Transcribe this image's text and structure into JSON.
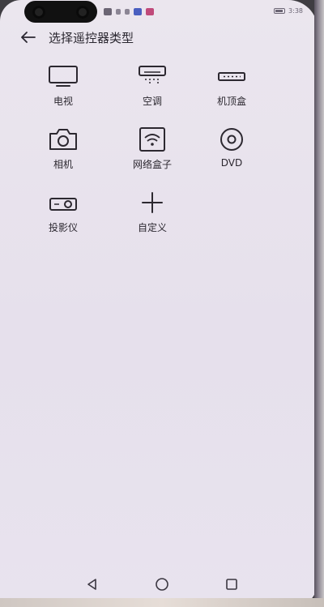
{
  "status_bar": {
    "time": "3:38"
  },
  "header": {
    "title": "选择遥控器类型"
  },
  "devices": [
    {
      "label": "电视",
      "icon": "tv-icon"
    },
    {
      "label": "空调",
      "icon": "air-conditioner-icon"
    },
    {
      "label": "机顶盒",
      "icon": "set-top-box-icon"
    },
    {
      "label": "相机",
      "icon": "camera-icon"
    },
    {
      "label": "网络盒子",
      "icon": "network-box-icon"
    },
    {
      "label": "DVD",
      "icon": "dvd-icon"
    },
    {
      "label": "投影仪",
      "icon": "projector-icon"
    },
    {
      "label": "自定义",
      "icon": "plus-icon"
    }
  ],
  "colors": {
    "background": "#e8e3ee",
    "text": "#2a2730",
    "icon": "#2c2830"
  }
}
